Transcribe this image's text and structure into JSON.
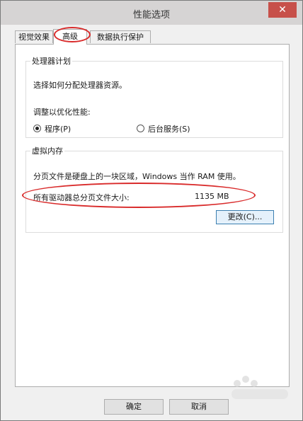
{
  "window": {
    "title": "性能选项",
    "close_glyph": "✕"
  },
  "tabs": [
    {
      "label": "视觉效果"
    },
    {
      "label": "高级"
    },
    {
      "label": "数据执行保护"
    }
  ],
  "processor": {
    "legend": "处理器计划",
    "desc": "选择如何分配处理器资源。",
    "adjust_label": "调整以优化性能:",
    "option_programs": "程序(P)",
    "option_services": "后台服务(S)"
  },
  "virtual_memory": {
    "legend": "虚拟内存",
    "desc": "分页文件是硬盘上的一块区域，Windows 当作 RAM 使用。",
    "total_label": "所有驱动器总分页文件大小:",
    "total_value": "1135 MB",
    "change_button": "更改(C)..."
  },
  "footer": {
    "ok_button": "确定",
    "cancel_button": "取消"
  },
  "colors": {
    "annotation": "#d92b2b",
    "titlebar": "#d6d4d4",
    "close": "#c7504a"
  },
  "icons": {
    "close": "close-icon",
    "watermark": "watermark-icon"
  }
}
